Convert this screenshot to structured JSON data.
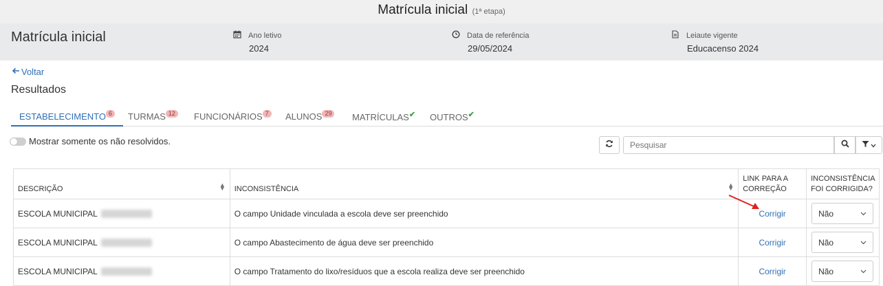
{
  "header": {
    "title": "Matrícula inicial",
    "subtitle": "(1ª etapa)"
  },
  "info_bar": {
    "page_title": "Matrícula inicial",
    "fields": [
      {
        "label": "Ano letivo",
        "value": "2024",
        "icon": "calendar-icon"
      },
      {
        "label": "Data de referência",
        "value": "29/05/2024",
        "icon": "clock-icon"
      },
      {
        "label": "Leiaute vigente",
        "value": "Educacenso 2024",
        "icon": "document-icon"
      }
    ]
  },
  "back_label": "Voltar",
  "results_title": "Resultados",
  "tabs": [
    {
      "label": "ESTABELECIMENTO",
      "badge": "6",
      "active": true
    },
    {
      "label": "TURMAS",
      "badge": "12"
    },
    {
      "label": "FUNCIONÁRIOS",
      "badge": "7"
    },
    {
      "label": "ALUNOS",
      "badge": "29"
    },
    {
      "label": "MATRÍCULAS",
      "badge": "✔"
    },
    {
      "label": "OUTROS",
      "badge": "✔"
    }
  ],
  "filter_toggle_label": "Mostrar somente os não resolvidos.",
  "search": {
    "placeholder": "Pesquisar"
  },
  "table": {
    "headers": {
      "descricao": "DESCRIÇÃO",
      "inconsistencia": "INCONSISTÊNCIA",
      "link": "LINK PARA A CORREÇÃO",
      "corrigida": "INCONSISTÊNCIA FOI CORRIGIDA?"
    },
    "rows": [
      {
        "descricao": "ESCOLA MUNICIPAL",
        "inconsistencia": "O campo Unidade vinculada a escola deve ser preenchido",
        "link": "Corrigir",
        "corrigida": "Não"
      },
      {
        "descricao": "ESCOLA MUNICIPAL",
        "inconsistencia": "O campo Abastecimento de água deve ser preenchido",
        "link": "Corrigir",
        "corrigida": "Não"
      },
      {
        "descricao": "ESCOLA MUNICIPAL",
        "inconsistencia": "O campo Tratamento do lixo/resíduos que a escola realiza deve ser preenchido",
        "link": "Corrigir",
        "corrigida": "Não"
      }
    ]
  },
  "colors": {
    "accent": "#2f6fb5",
    "badge_bg": "#f2b6b6",
    "success": "#3fa04a",
    "annotation": "#e02020"
  }
}
